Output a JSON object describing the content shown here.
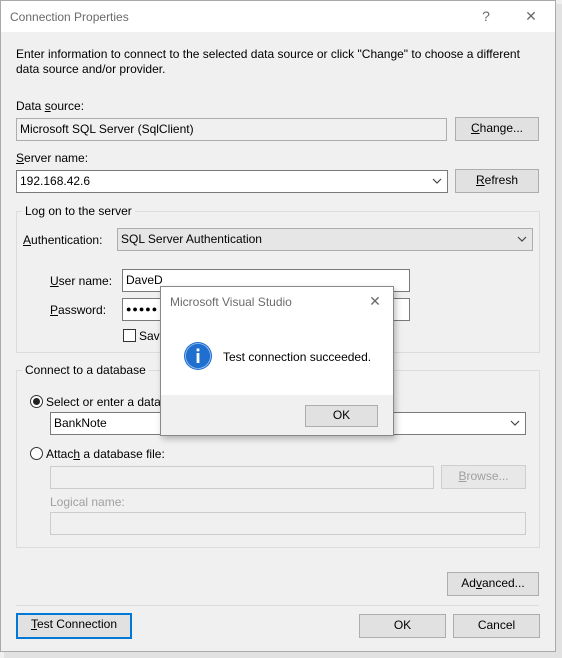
{
  "window": {
    "title": "Connection Properties",
    "help": "?",
    "close": "✕"
  },
  "description": "Enter information to connect to the selected data source or click \"Change\" to choose a different data source and/or provider.",
  "datasource": {
    "label_pre": "Data ",
    "label_u": "s",
    "label_post": "ource:",
    "value": "Microsoft SQL Server (SqlClient)",
    "change_u": "C",
    "change_post": "hange..."
  },
  "server": {
    "label_u": "S",
    "label_post": "erver name:",
    "value": "192.168.42.6",
    "refresh_u": "R",
    "refresh_post": "efresh"
  },
  "logon": {
    "title": "Log on to the server",
    "auth_label_u": "A",
    "auth_label_post": "uthentication:",
    "auth_value": "SQL Server Authentication",
    "user_label_u": "U",
    "user_label_post": "ser name:",
    "user_value": "DaveD",
    "pass_label_u": "P",
    "pass_label_post": "assword:",
    "pass_value": "●●●●●",
    "save_label": "Save"
  },
  "database": {
    "title": "Connect to a database",
    "select_label": "Select or enter a datab",
    "select_value": "BankNote",
    "attach_pre": "Attac",
    "attach_u": "h",
    "attach_post": " a database file:",
    "browse_u": "B",
    "browse_post": "rowse...",
    "logical_label": "Logical name:"
  },
  "buttons": {
    "advanced_pre": "Ad",
    "advanced_u": "v",
    "advanced_post": "anced...",
    "test_u": "T",
    "test_post": "est Connection",
    "ok": "OK",
    "cancel": "Cancel"
  },
  "messagebox": {
    "title": "Microsoft Visual Studio",
    "close": "✕",
    "text": "Test connection succeeded.",
    "ok": "OK"
  },
  "colors": {
    "accent": "#0078d7"
  }
}
